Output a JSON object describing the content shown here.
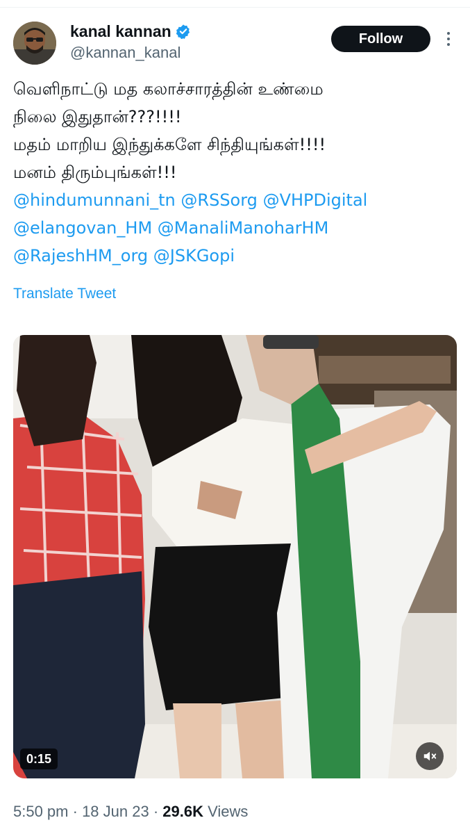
{
  "author": {
    "display_name": "kanal kannan",
    "handle": "@kannan_kanal",
    "verified_icon": "verified-badge-icon"
  },
  "follow_label": "Follow",
  "tweet": {
    "lines": [
      "வெளிநாட்டு மத கலாச்சாரத்தின் உண்மை",
      "நிலை இதுதான்???!!!!",
      "மதம் மாறிய இந்துக்களே சிந்தியுங்கள்!!!!",
      "மனம் திரும்புங்கள்!!!"
    ],
    "mentions": [
      "@hindumunnani_tn",
      "@RSSorg",
      "@VHPDigital",
      "@elangovan_HM",
      "@ManaliManoharHM",
      "@RajeshHM_org",
      "@JSKGopi"
    ],
    "translate_label": "Translate Tweet"
  },
  "video": {
    "duration": "0:15",
    "mute_icon": "speaker-muted-icon"
  },
  "meta": {
    "time": "5:50 pm",
    "sep1": " · ",
    "date": "18 Jun 23",
    "sep2": " · ",
    "views_count": "29.6K",
    "views_label": " Views"
  },
  "colors": {
    "accent": "#1d9bf0",
    "text": "#0f1419",
    "secondary": "#536471",
    "follow_bg": "#0f1419"
  }
}
